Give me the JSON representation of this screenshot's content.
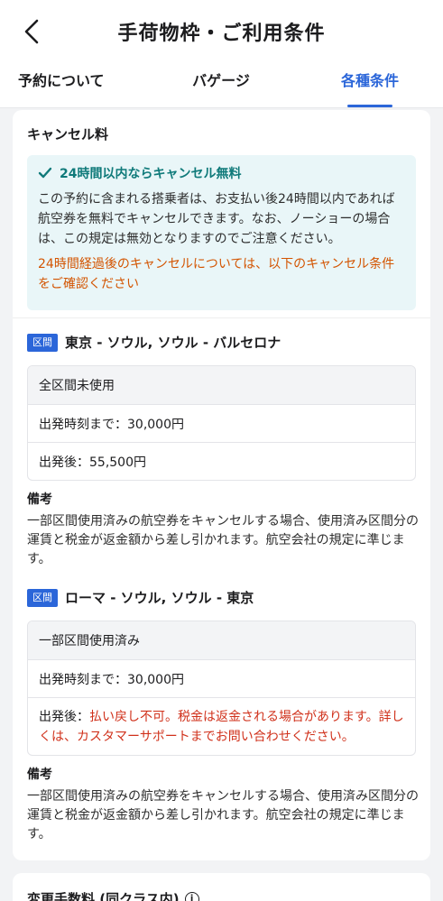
{
  "header": {
    "title": "手荷物枠・ご利用条件"
  },
  "tabs": [
    {
      "label": "予約について"
    },
    {
      "label": "バゲージ"
    },
    {
      "label": "各種条件"
    }
  ],
  "cancel": {
    "title": "キャンセル料",
    "notice": {
      "headline": "24時間以内ならキャンセル無料",
      "body": "この予約に含まれる搭乗者は、お支払い後24時間以内であれば航空券を無料でキャンセルできます。なお、ノーショーの場合は、この規定は無効となりますのでご注意ください。",
      "warning": "24時間経過後のキャンセルについては、以下のキャンセル条件をご確認ください"
    },
    "segments": [
      {
        "badge": "区間",
        "route": "東京 - ソウル, ソウル - バルセロナ",
        "rows": [
          "全区間未使用",
          "出発時刻まで：30,000円",
          "出発後：55,500円"
        ],
        "note_title": "備考",
        "note": "一部区間使用済みの航空券をキャンセルする場合、使用済み区間分の運賃と税金が返金額から差し引かれます。航空会社の規定に準じます。"
      },
      {
        "badge": "区間",
        "route": "ローマ - ソウル, ソウル - 東京",
        "rows": [
          "一部区間使用済み",
          "出発時刻まで：30,000円"
        ],
        "after_label": "出発後：",
        "after_warning": "払い戻し不可。税金は返金される場合があります。詳しくは、カスタマーサポートまでお問い合わせください。",
        "note_title": "備考",
        "note": "一部区間使用済みの航空券をキャンセルする場合、使用済み区間分の運賃と税金が返金額から差し引かれます。航空会社の規定に準じます。"
      }
    ]
  },
  "change": {
    "title": "変更手数料 (同クラス内)",
    "info_icon": "i"
  },
  "colors": {
    "accent": "#2b66d9",
    "notice_bg": "#e9f6f8",
    "success": "#0f7a7a",
    "warning": "#d35400",
    "danger": "#d0311b"
  },
  "icons": {
    "back": "chevron-left-icon",
    "check": "check-icon",
    "info": "info-icon"
  }
}
